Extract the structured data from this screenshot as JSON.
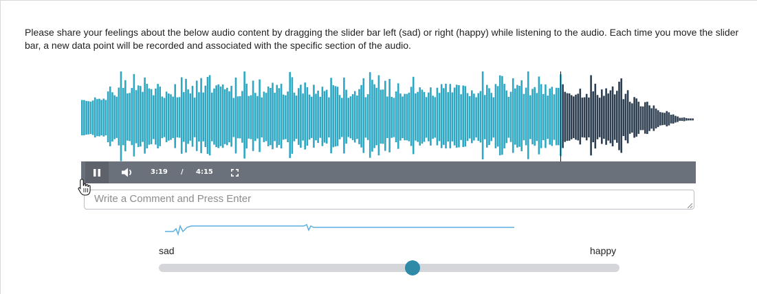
{
  "instructions": "Please share your feelings about the below audio content by dragging the slider bar left (sad) or right (happy) while listening to the audio. Each time you move the slider bar, a new data point will be recorded and associated with the specific section of the audio.",
  "player": {
    "state": "playing",
    "current_time": "3:19",
    "separator": "/",
    "total_time": "4:15",
    "progress_fraction": 0.78,
    "icons": {
      "play_pause": "pause-icon",
      "volume": "volume-icon",
      "fullscreen": "fullscreen-icon"
    }
  },
  "comment": {
    "placeholder": "Write a Comment and Press Enter",
    "value": ""
  },
  "slider": {
    "left_label": "sad",
    "right_label": "happy",
    "value_fraction": 0.55
  },
  "colors": {
    "played": "#2ea7c2",
    "unplayed": "#2c3e50",
    "controls_bg": "#6b717a",
    "thumb": "#2e8aa7",
    "sparkline": "#5aaee0"
  }
}
